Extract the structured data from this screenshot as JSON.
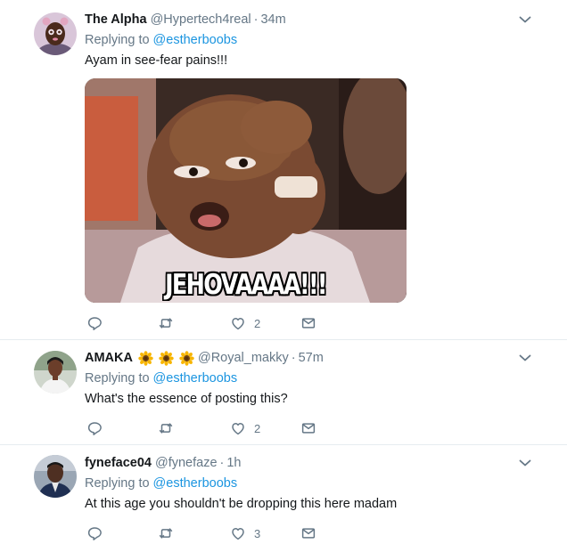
{
  "tweets": [
    {
      "name": "The Alpha",
      "handle": "@Hypertech4real",
      "separator": "·",
      "time": "34m",
      "replying_label": "Replying to",
      "replying_to": "@estherboobs",
      "text": "Ayam in see-fear pains!!!",
      "media_caption": "JEHOVAAAA!!!",
      "likes": "2",
      "icons": [
        "chevron-down-icon",
        "reply-icon",
        "retweet-icon",
        "like-icon",
        "message-icon"
      ]
    },
    {
      "name": "AMAKA",
      "name_emoji": [
        "sunflower-icon",
        "sunflower-icon",
        "sunflower-icon"
      ],
      "handle": "@Royal_makky",
      "separator": "·",
      "time": "57m",
      "replying_label": "Replying to",
      "replying_to": "@estherboobs",
      "text": "What's the essence of posting this?",
      "likes": "2",
      "icons": [
        "chevron-down-icon",
        "reply-icon",
        "retweet-icon",
        "like-icon",
        "message-icon"
      ]
    },
    {
      "name": "fyneface04",
      "handle": "@fynefaze",
      "separator": "·",
      "time": "1h",
      "replying_label": "Replying to",
      "replying_to": "@estherboobs",
      "text": "At this age you shouldn't be dropping this here madam",
      "likes": "3",
      "icons": [
        "chevron-down-icon",
        "reply-icon",
        "retweet-icon",
        "like-icon",
        "message-icon"
      ]
    }
  ],
  "colors": {
    "text": "#14171a",
    "secondary": "#657786",
    "link": "#1b95e0",
    "divider": "#e6ecf0"
  }
}
